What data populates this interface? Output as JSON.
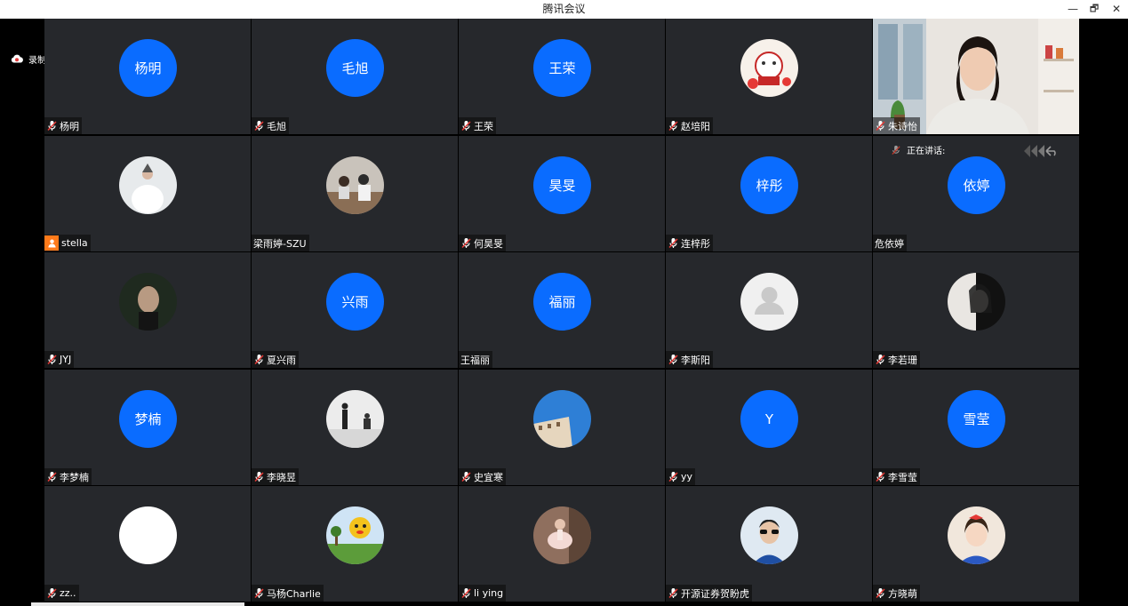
{
  "window": {
    "title": "腾讯会议",
    "minimize": "—",
    "restore": "🗗",
    "close": "✕"
  },
  "recording": {
    "label": "录制中"
  },
  "colors": {
    "avatar_blue": "#0a6cff",
    "tile_bg": "#26282c",
    "host_badge": "#ff7a1a"
  },
  "participants": [
    {
      "name": "杨明",
      "avatar_text": "杨明",
      "avatar": "text",
      "mic": true
    },
    {
      "name": "毛旭",
      "avatar_text": "毛旭",
      "avatar": "text",
      "mic": true
    },
    {
      "name": "王荣",
      "avatar_text": "王荣",
      "avatar": "text",
      "mic": true
    },
    {
      "name": "赵培阳",
      "avatar": "photo-festive",
      "mic": true
    },
    {
      "name": "朱诗怡",
      "avatar": "video",
      "mic": true
    },
    {
      "name": "stella",
      "avatar": "photo-bride",
      "mic": false,
      "host": true
    },
    {
      "name": "梁雨婷-SZU",
      "avatar": "photo-room",
      "mic": false
    },
    {
      "name": "何昊旻",
      "avatar_text": "昊旻",
      "avatar": "text",
      "mic": true
    },
    {
      "name": "连梓彤",
      "avatar_text": "梓彤",
      "avatar": "text",
      "mic": true
    },
    {
      "name": "危依婷",
      "avatar_text": "依婷",
      "avatar": "text",
      "mic": false,
      "speaking_label": "正在讲话:"
    },
    {
      "name": "JYJ",
      "avatar": "photo-dark",
      "mic": true
    },
    {
      "name": "夏兴雨",
      "avatar_text": "兴雨",
      "avatar": "text",
      "mic": true
    },
    {
      "name": "王福丽",
      "avatar_text": "福丽",
      "avatar": "text",
      "mic": false
    },
    {
      "name": "李斯阳",
      "avatar": "default-user",
      "mic": true
    },
    {
      "name": "李若珊",
      "avatar": "photo-bw",
      "mic": true
    },
    {
      "name": "李梦楠",
      "avatar_text": "梦楠",
      "avatar": "text",
      "mic": true
    },
    {
      "name": "李晓昱",
      "avatar": "photo-studio",
      "mic": true
    },
    {
      "name": "史宜寒",
      "avatar": "photo-sky",
      "mic": true
    },
    {
      "name": "yy",
      "avatar_text": "Y",
      "avatar": "text",
      "mic": true
    },
    {
      "name": "李雪莹",
      "avatar_text": "雪莹",
      "avatar": "text",
      "mic": true
    },
    {
      "name": "zz..",
      "avatar": "photo-white",
      "mic": true
    },
    {
      "name": "马杨Charlie",
      "avatar": "photo-cartoon",
      "mic": true
    },
    {
      "name": "li ying",
      "avatar": "photo-ballet",
      "mic": true
    },
    {
      "name": "开源证券贺盼虎",
      "avatar": "photo-man",
      "mic": true
    },
    {
      "name": "方晓萌",
      "avatar": "photo-girl",
      "mic": true
    }
  ]
}
